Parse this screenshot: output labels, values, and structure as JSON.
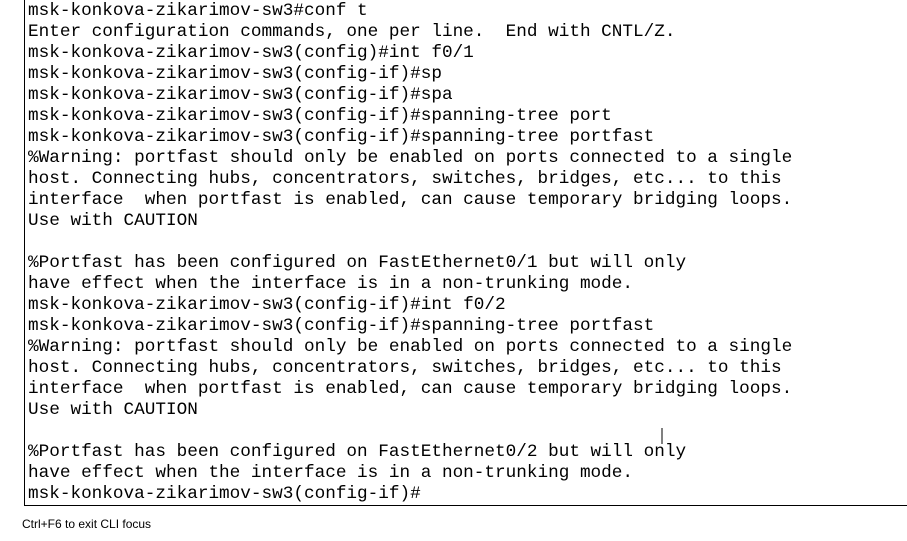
{
  "terminal": {
    "lines": [
      "msk-konkova-zikarimov-sw3#conf t",
      "Enter configuration commands, one per line.  End with CNTL/Z.",
      "msk-konkova-zikarimov-sw3(config)#int f0/1",
      "msk-konkova-zikarimov-sw3(config-if)#sp",
      "msk-konkova-zikarimov-sw3(config-if)#spa",
      "msk-konkova-zikarimov-sw3(config-if)#spanning-tree port",
      "msk-konkova-zikarimov-sw3(config-if)#spanning-tree portfast",
      "%Warning: portfast should only be enabled on ports connected to a single",
      "host. Connecting hubs, concentrators, switches, bridges, etc... to this",
      "interface  when portfast is enabled, can cause temporary bridging loops.",
      "Use with CAUTION",
      "",
      "%Portfast has been configured on FastEthernet0/1 but will only",
      "have effect when the interface is in a non-trunking mode.",
      "msk-konkova-zikarimov-sw3(config-if)#int f0/2",
      "msk-konkova-zikarimov-sw3(config-if)#spanning-tree portfast",
      "%Warning: portfast should only be enabled on ports connected to a single",
      "host. Connecting hubs, concentrators, switches, bridges, etc... to this",
      "interface  when portfast is enabled, can cause temporary bridging loops.",
      "Use with CAUTION",
      "",
      "%Portfast has been configured on FastEthernet0/2 but will only",
      "have effect when the interface is in a non-trunking mode.",
      "msk-konkova-zikarimov-sw3(config-if)#"
    ]
  },
  "footer": {
    "hint": "Ctrl+F6 to exit CLI focus"
  }
}
